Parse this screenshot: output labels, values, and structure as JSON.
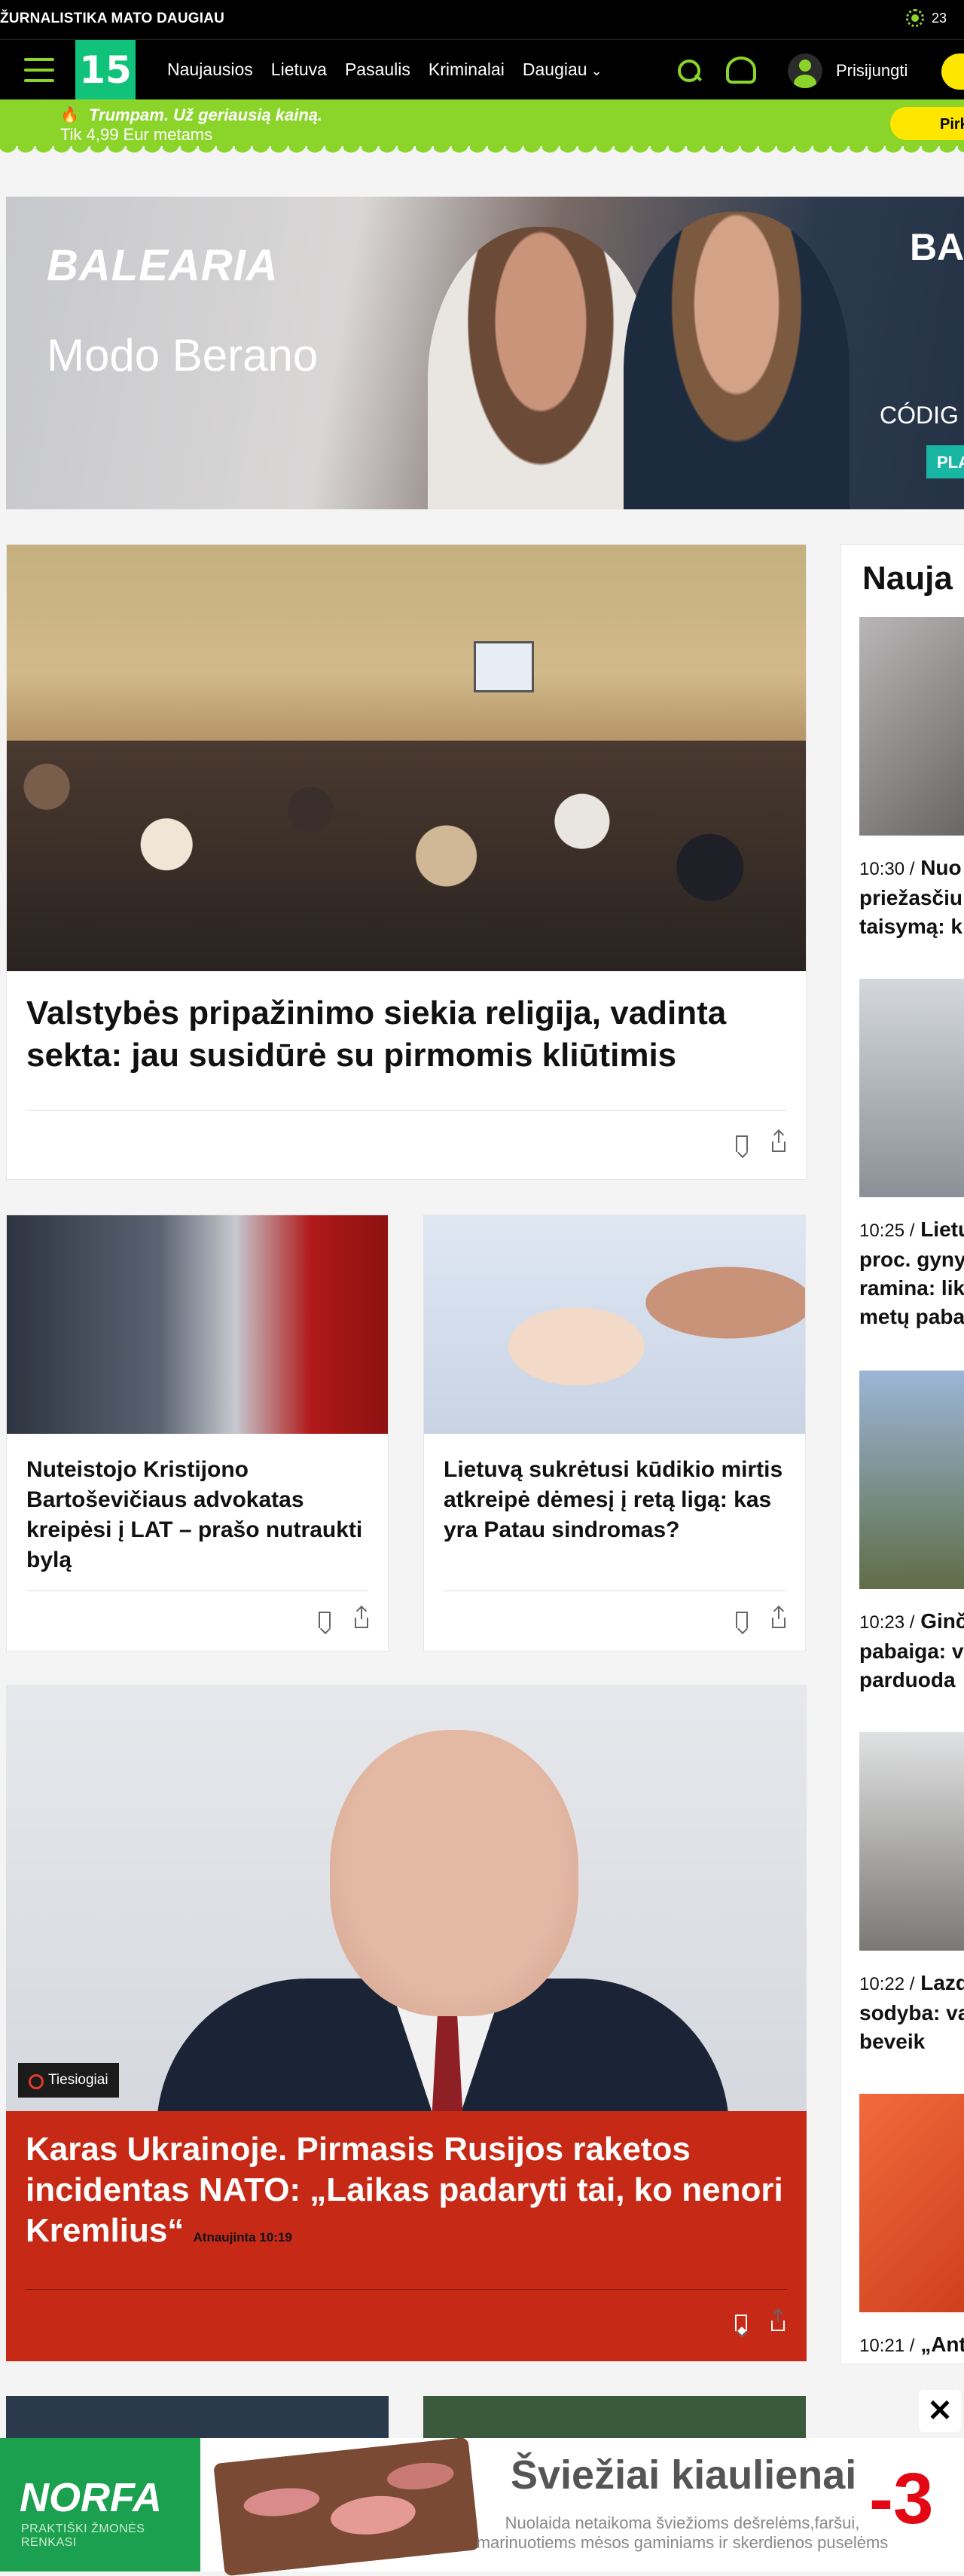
{
  "topbar": {
    "brandline": "ŽURNALISTIKA MATO DAUGIAU",
    "temperature": "23"
  },
  "nav": {
    "logo": "15",
    "items": [
      "Naujausios",
      "Lietuva",
      "Pasaulis",
      "Kriminalai",
      "Daugiau"
    ],
    "login": "Prisijungti"
  },
  "promo": {
    "line1": "Trumpam. Už geriausią kainą.",
    "line2": "Tik 4,99 Eur metams",
    "button": "Pirk"
  },
  "ad_top": {
    "brand": "BALEARIA",
    "slogan": "Modo Berano",
    "right_text": "BA",
    "code_label": "CÓDIG",
    "cta": "PLA"
  },
  "main": {
    "feature": {
      "title": "Valstybės pripažinimo siekia religija, vadinta sekta: jau susidūrė su pirmomis kliūtimis"
    },
    "card_left": {
      "title": "Nuteistojo Kristijono Bartoševičiaus advokatas kreipėsi į LAT – prašo nutraukti bylą"
    },
    "card_right": {
      "title": "Lietuvą sukrėtusi kūdikio mirtis atkreipė dėmesį į retą ligą: kas yra Patau sindromas?"
    },
    "live": {
      "badge": "Tiesiogiai",
      "title": "Karas Ukrainoje. Pirmasis Rusijos raketos incidentas NATO: „Laikas padaryti tai, ko nenori Kremlius“",
      "updated": "Atnaujinta 10:19",
      "bg_color": "#c62a16"
    }
  },
  "sidebar": {
    "title": "Nauja",
    "items": [
      {
        "time": "10:30 /",
        "text": "Nuo priežasčiu taisymą: k"
      },
      {
        "time": "10:25 /",
        "text": "Lietu proc. gyny ramina: lik metų paba"
      },
      {
        "time": "10:23 /",
        "text": "Ginč pabaiga: v parduoda"
      },
      {
        "time": "10:22 /",
        "text": "Lazd sodyba: va už beveik"
      },
      {
        "time": "10:21 /",
        "text": "„Anti"
      }
    ]
  },
  "ad_bottom": {
    "brand": "NORFA",
    "brand_sub": "PRAKTIŠKI ŽMONĖS RENKASI",
    "headline": "Šviežiai kiaulienai",
    "small": "Nuolaida netaikoma šviežioms dešrelėms,faršui, marinuotiems mėsos gaminiams ir skerdienos puselėms",
    "pct": "-3",
    "close": "✕"
  }
}
